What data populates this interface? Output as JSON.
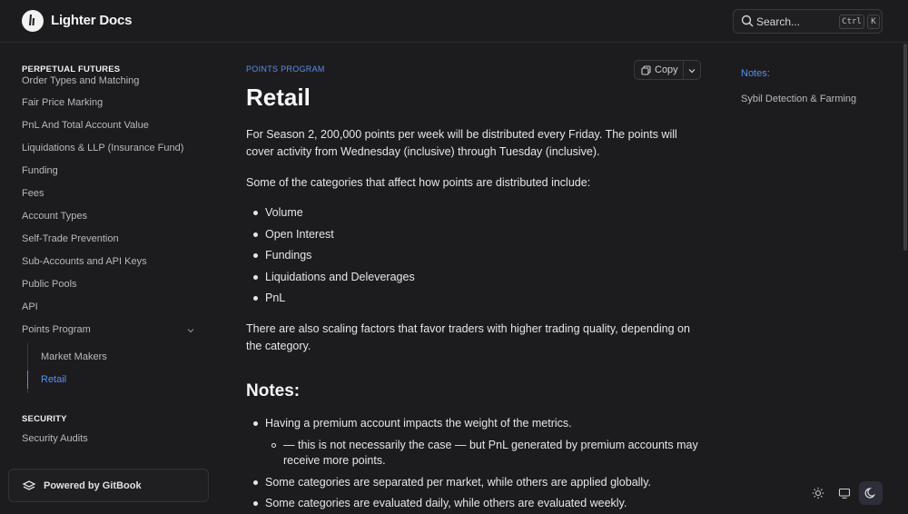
{
  "header": {
    "brand": "Lighter Docs",
    "search": {
      "label": "Search...",
      "shortcut_ctrl": "Ctrl",
      "shortcut_key": "K"
    }
  },
  "sidebar": {
    "section_perp": "PERPETUAL FUTURES",
    "items": [
      {
        "label": "Order Types and Matching"
      },
      {
        "label": "Fair Price Marking"
      },
      {
        "label": "PnL And Total Account Value"
      },
      {
        "label": "Liquidations & LLP (Insurance Fund)"
      },
      {
        "label": "Funding"
      },
      {
        "label": "Fees"
      },
      {
        "label": "Account Types"
      },
      {
        "label": "Self-Trade Prevention"
      },
      {
        "label": "Sub-Accounts and API Keys"
      },
      {
        "label": "Public Pools"
      },
      {
        "label": "API"
      },
      {
        "label": "Points Program"
      }
    ],
    "sub_items": [
      {
        "label": "Market Makers"
      },
      {
        "label": "Retail"
      }
    ],
    "section_security": "SECURITY",
    "security_items": [
      {
        "label": "Security Audits"
      }
    ],
    "powered_by": "Powered by GitBook"
  },
  "main": {
    "eyebrow": "POINTS PROGRAM",
    "title": "Retail",
    "copy_label": "Copy",
    "intro": "For Season 2, 200,000 points per week will be distributed every Friday. The points will cover activity from Wednesday (inclusive) through Tuesday (inclusive).",
    "categories_intro": "Some of the categories that affect how points are distributed include:",
    "categories": [
      "Volume",
      "Open Interest",
      "Fundings",
      "Liquidations and Deleverages",
      "PnL"
    ],
    "scaling": "There are also scaling factors that favor traders with higher trading quality, depending on the category.",
    "notes_heading": "Notes:",
    "notes": [
      "Having a premium account impacts the weight of the metrics.",
      "Some categories are separated per market, while others are applied globally.",
      "Some categories are evaluated daily, while others are evaluated weekly."
    ],
    "note_sub": "— this is not necessarily the case — but PnL generated by premium accounts may receive more points."
  },
  "toc": {
    "title": "Notes:",
    "items": [
      "Sybil Detection & Farming"
    ]
  },
  "colors": {
    "background": "#1c1c1e",
    "accent": "#5b8def",
    "text": "#e6e6e6"
  }
}
